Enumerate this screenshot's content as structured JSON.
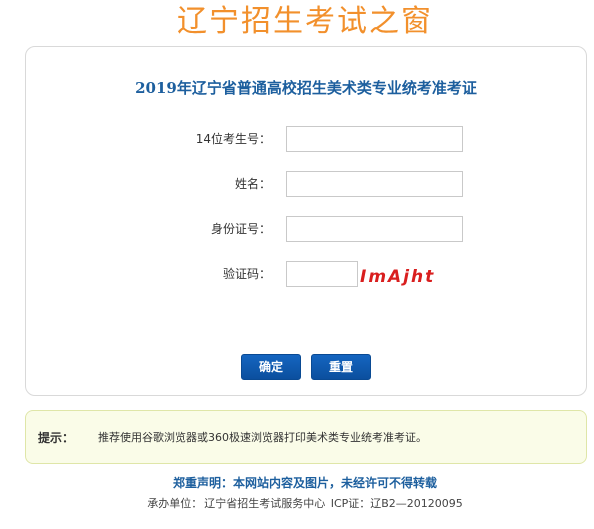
{
  "header": {
    "site_title": "辽宁招生考试之窗"
  },
  "form": {
    "title": "2019年辽宁省普通高校招生美术类专业统考准考证",
    "fields": [
      {
        "label": "14位考生号：",
        "value": "",
        "placeholder": ""
      },
      {
        "label": "姓名：",
        "value": "",
        "placeholder": ""
      },
      {
        "label": "身份证号：",
        "value": "",
        "placeholder": ""
      }
    ],
    "captcha": {
      "label": "验证码：",
      "value": "",
      "image_text": "ImAjht",
      "image_color": "#d91e1e"
    },
    "buttons": {
      "confirm_label": "确定",
      "reset_label": "重置"
    }
  },
  "tip": {
    "label": "提示：",
    "text": "推荐使用谷歌浏览器或360极速浏览器打印美术类专业统考准考证。"
  },
  "footer": {
    "notice": "郑重声明：本网站内容及图片，未经许可不得转载",
    "sponsor_label": "承办单位：",
    "sponsor_name": "辽宁省招生考试服务中心",
    "icp": "ICP证：辽B2—20120095"
  },
  "colors": {
    "title_orange": "#f2902c",
    "heading_blue": "#1d5f9e",
    "button_blue": "#1565c0",
    "tip_background": "#fafce8"
  }
}
